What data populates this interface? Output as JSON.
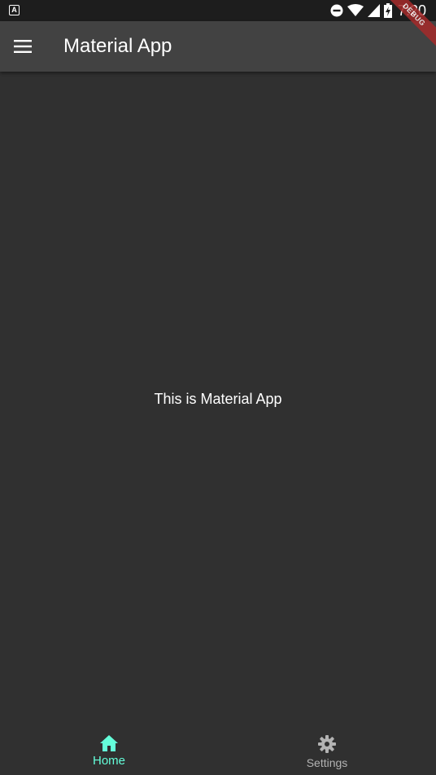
{
  "status_bar": {
    "app_icon_letter": "A",
    "time": "7:20",
    "icons": [
      "app-notification-icon",
      "do-not-disturb-icon",
      "wifi-icon",
      "signal-icon",
      "battery-charging-icon"
    ]
  },
  "debug_banner": {
    "label": "DEBUG"
  },
  "app_bar": {
    "title": "Material App",
    "menu_icon": "menu-icon"
  },
  "body": {
    "message": "This is Material App"
  },
  "bottom_nav": {
    "items": [
      {
        "label": "Home",
        "icon": "home-icon",
        "selected": true
      },
      {
        "label": "Settings",
        "icon": "settings-icon",
        "selected": false
      }
    ]
  },
  "colors": {
    "background": "#303030",
    "app_bar": "#424242",
    "status_bar": "#1d1d1d",
    "accent": "#64ffda",
    "inactive": "#b3b3b3",
    "debug_banner": "#a52a2a"
  }
}
